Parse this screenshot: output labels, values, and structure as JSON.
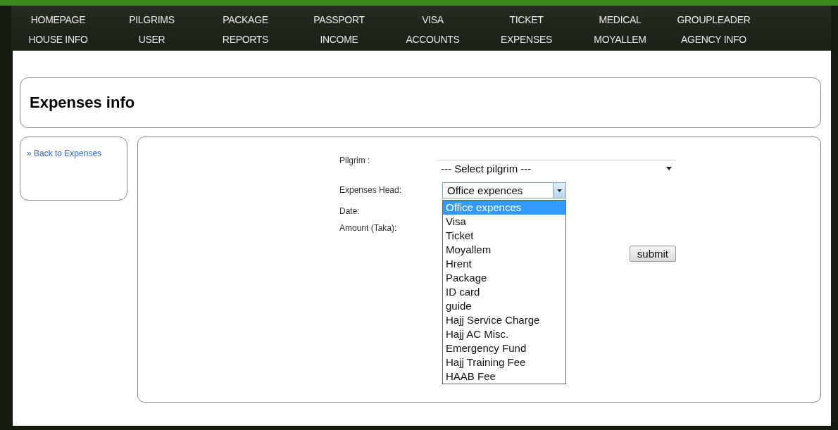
{
  "nav": [
    [
      "HOMEPAGE",
      "PILGRIMS",
      "PACKAGE",
      "PASSPORT",
      "VISA",
      "TICKET",
      "MEDICAL",
      "GROUPLEADER"
    ],
    [
      "HOUSE INFO",
      "USER",
      "REPORTS",
      "INCOME",
      "ACCOUNTS",
      "EXPENSES",
      "MOYALLEM",
      "AGENCY INFO"
    ]
  ],
  "page_title": "Expenses info",
  "sidebar": {
    "links": [
      "» Back to Expenses"
    ]
  },
  "form": {
    "fields": [
      {
        "kind": "select",
        "label": "Pilgrim :",
        "value": "--- Select pilgrim ---"
      },
      {
        "kind": "dropdown",
        "label": "Expenses Head:",
        "value": "Office expences",
        "expanded": true,
        "options": [
          {
            "label": "Office expences",
            "selected": true
          },
          {
            "label": "Visa",
            "selected": false
          },
          {
            "label": "Ticket",
            "selected": false
          },
          {
            "label": "Moyallem",
            "selected": false
          },
          {
            "label": "Hrent",
            "selected": false
          },
          {
            "label": "Package",
            "selected": false
          },
          {
            "label": "ID card",
            "selected": false
          },
          {
            "label": "guide",
            "selected": false
          },
          {
            "label": "Hajj Service Charge",
            "selected": false
          },
          {
            "label": "Hajj AC Misc.",
            "selected": false
          },
          {
            "label": "Emergency Fund",
            "selected": false
          },
          {
            "label": "Hajj Training Fee",
            "selected": false
          },
          {
            "label": "HAAB Fee",
            "selected": false
          }
        ]
      },
      {
        "kind": "input",
        "label": "Date:"
      },
      {
        "kind": "input",
        "label": "Amount (Taka):"
      }
    ],
    "submit": "submit"
  }
}
